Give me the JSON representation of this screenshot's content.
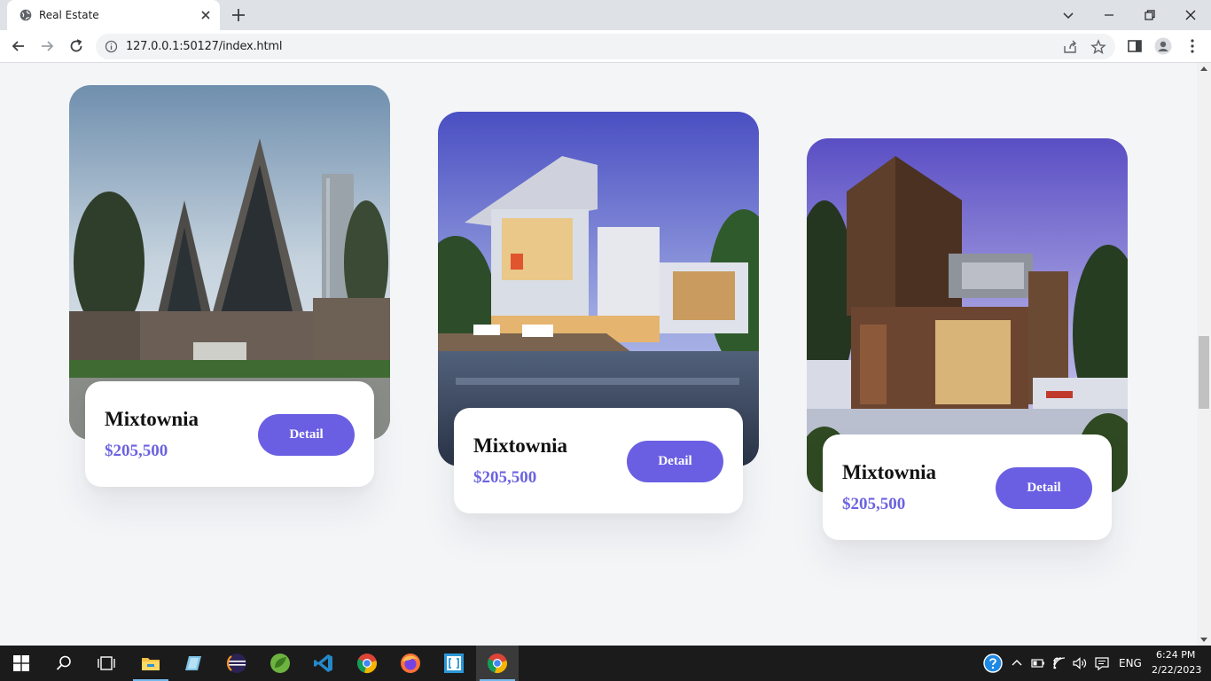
{
  "browser": {
    "tab_title": "Real Estate",
    "url": "127.0.0.1:50127/index.html"
  },
  "cards": [
    {
      "name": "Mixtownia",
      "price": "$205,500",
      "button": "Detail"
    },
    {
      "name": "Mixtownia",
      "price": "$205,500",
      "button": "Detail"
    },
    {
      "name": "Mixtownia",
      "price": "$205,500",
      "button": "Detail"
    }
  ],
  "colors": {
    "accent": "#6a5fe3",
    "price": "#6c63e0",
    "page_bg": "#f4f5f7"
  },
  "taskbar": {
    "apps": [
      "start-icon",
      "search-icon",
      "task-view-icon",
      "file-explorer-icon",
      "notepad-icon",
      "eclipse-icon",
      "spring-icon",
      "vscode-icon",
      "chrome-icon",
      "firefox-icon",
      "bracket-app-icon",
      "chrome-active-icon"
    ],
    "language": "ENG",
    "time": "6:24 PM",
    "date": "2/22/2023"
  }
}
